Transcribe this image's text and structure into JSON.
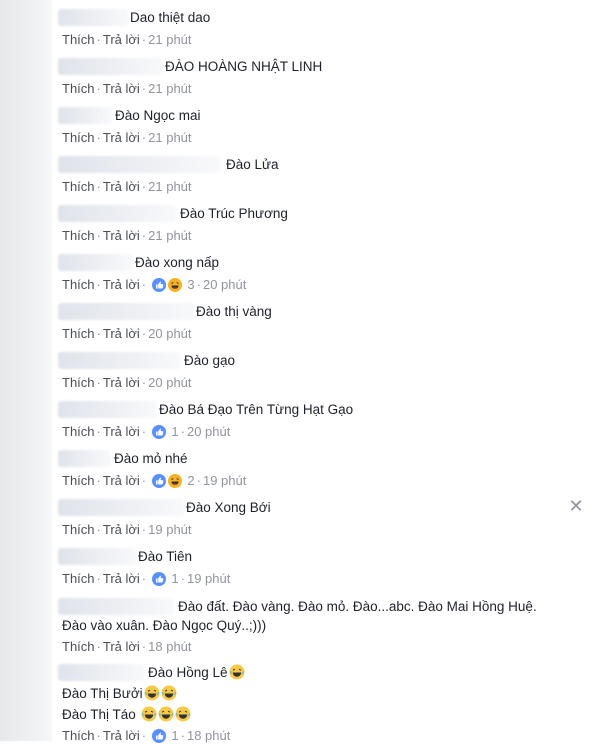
{
  "actions": {
    "like": "Thích",
    "reply": "Trả lời"
  },
  "comments": [
    {
      "text": "Dao thiệt dao",
      "time": "21 phút"
    },
    {
      "text": "ĐÀO HOÀNG NHẬT LINH",
      "time": "21 phút"
    },
    {
      "text": "Đào Ngọc mai",
      "time": "21 phút"
    },
    {
      "text": "Đào Lửa",
      "time": "21 phút"
    },
    {
      "text": "Đào Trúc Phương",
      "time": "21 phút"
    },
    {
      "text": "Đào xong nấp",
      "time": "20 phút",
      "reactions": "3"
    },
    {
      "text": "Đào thị vàng",
      "time": "20 phút"
    },
    {
      "text": "Đào gạo",
      "time": "20 phút"
    },
    {
      "text": "Đào Bá Đạo Trên Từng Hạt Gạo",
      "time": "20 phút",
      "reactions": "1"
    },
    {
      "text": "Đào mỏ nhé",
      "time": "19 phút",
      "reactions": "2"
    },
    {
      "text": "Đào Xong Bới",
      "time": "19 phút"
    },
    {
      "text": "Đào Tiên",
      "time": "19 phút",
      "reactions": "1"
    },
    {
      "text": "Đào đất. Đào vàng. Đào mỏ. Đào...abc. Đào Mai Hồng Huệ.",
      "text2": "Đào vào xuân. Đào Ngọc Quý..;)))",
      "time": "18 phút"
    },
    {
      "text": "Đào Hồng Lê",
      "text2": "Đào Thị Bưởi",
      "text3": "Đào Thị Táo",
      "time": "18 phút",
      "reactions": "1"
    }
  ]
}
